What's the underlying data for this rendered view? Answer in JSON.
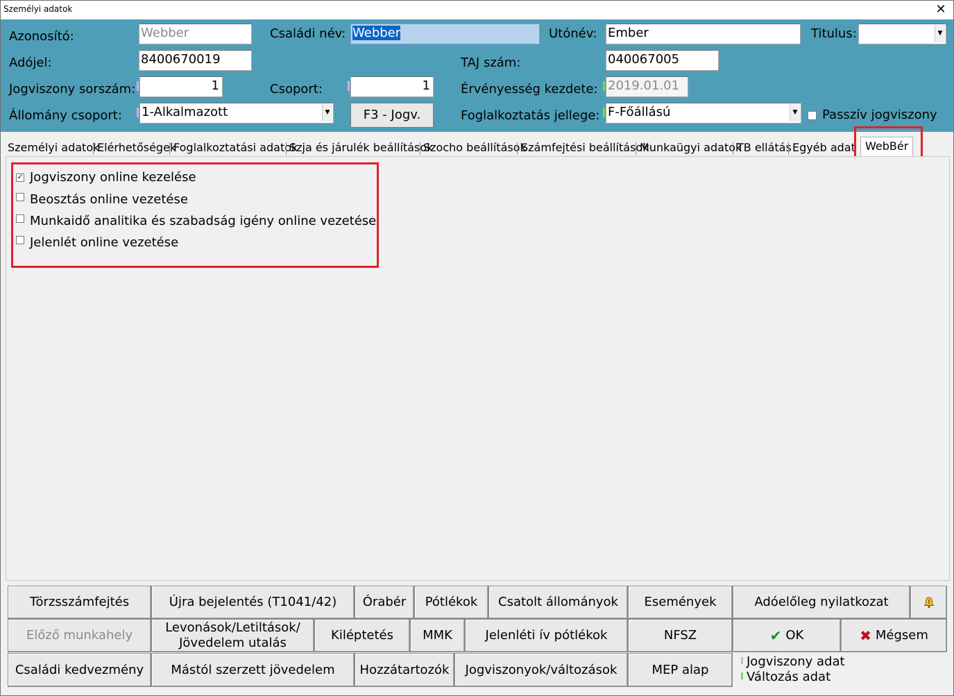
{
  "window": {
    "title": "Személyi adatok",
    "close_glyph": "✕"
  },
  "header": {
    "azonosito_label": "Azonosító:",
    "azonosito_value": "Webber",
    "csaladi_nev_label": "Családi név:",
    "csaladi_nev_value": "Webber",
    "utonev_label": "Utónév:",
    "utonev_value": "Ember",
    "titulus_label": "Titulus:",
    "titulus_value": "",
    "adojel_label": "Adójel:",
    "adojel_value": "8400670019",
    "taj_label": "TAJ szám:",
    "taj_value": "040067005",
    "jogviszony_sorszam_label": "Jogviszony sorszám:",
    "jogviszony_sorszam_value": "1",
    "csoport_label": "Csoport:",
    "csoport_value": "1",
    "ervenyesseg_label": "Érvényesség kezdete:",
    "ervenyesseg_value": "2019.01.01",
    "allomany_label": "Állomány csoport:",
    "allomany_value": "1-Alkalmazott",
    "f3_button": "F3 - Jogv.",
    "foglalkoztatas_label": "Foglalkoztatás jellege:",
    "foglalkoztatas_value": "F-Főállású",
    "passziv_label": "Passzív jogviszony",
    "passziv_checked": false,
    "header_color": "#4f9eb8"
  },
  "tabs": [
    "Személyi adatok",
    "Elérhetőségek",
    "Foglalkoztatási adatok",
    "Szja és járulék beállítások",
    "Szocho beállítások",
    "Számfejtési beállítások",
    "Munkaügyi adatok",
    "TB ellátás",
    "Egyéb adatok",
    "WebBér"
  ],
  "active_tab": "WebBér",
  "webber_options": [
    {
      "label": "Jogviszony online kezelése",
      "checked": true
    },
    {
      "label": "Beosztás online vezetése",
      "checked": false
    },
    {
      "label": "Munkaidő analitika és szabadság igény online vezetése",
      "checked": false
    },
    {
      "label": "Jelenlét online vezetése",
      "checked": false
    }
  ],
  "buttons": {
    "row1": {
      "torzsszamfejtes": "Törzsszámfejtés",
      "ujra_bejelentes": "Újra bejelentés (T1041/42)",
      "oraber": "Órabér",
      "potlekok": "Pótlékok",
      "csatolt": "Csatolt állományok",
      "esemenyek": "Események",
      "adoeloleg": "Adóelőleg nyilatkozat",
      "alert_icon": "alert-bell-icon"
    },
    "row2": {
      "elozo_munkahely": "Előző munkahely",
      "levonasok_line1": "Levonások/Letiltások/",
      "levonasok_line2": "Jövedelem utalás",
      "kileptetes": "Kiléptetés",
      "mmk": "MMK",
      "jelenleti": "Jelenléti ív pótlékok",
      "nfsz": "NFSZ",
      "ok": "OK",
      "megsem": "Mégsem"
    },
    "row3": {
      "csaladi_kedvezmeny": "Családi kedvezmény",
      "mastol": "Mástól szerzett jövedelem",
      "hozzatartozok": "Hozzátartozók",
      "jogviszonyok": "Jogviszonyok/változások",
      "mep": "MEP alap"
    }
  },
  "legend": {
    "jogviszony_adat": "Jogviszony adat",
    "valtozas_adat": "Változás adat",
    "jogviszony_color": "#d8a8e8",
    "valtozas_color": "#7cd84a"
  },
  "highlight_color": "#e0202a"
}
